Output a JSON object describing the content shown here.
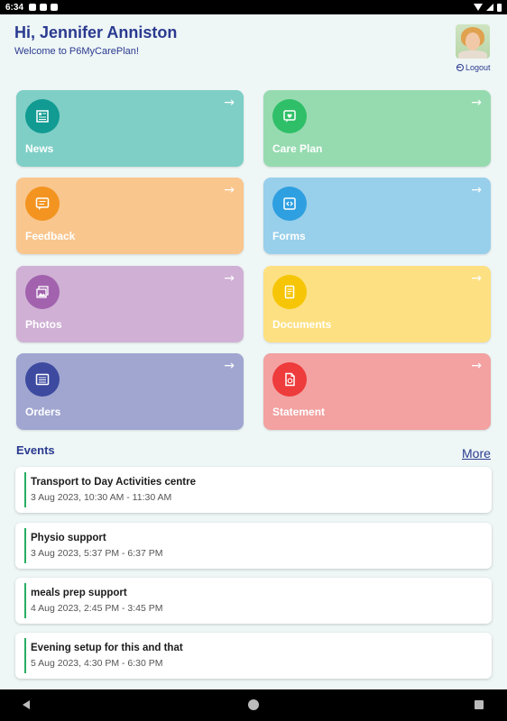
{
  "status_bar": {
    "time": "6:34"
  },
  "header": {
    "greeting": "Hi, Jennifer Anniston",
    "welcome": "Welcome to P6MyCarePlan!",
    "logout": "Logout"
  },
  "tiles": [
    {
      "label": "News",
      "color": "#7fcfc6",
      "icon_color": "#119b92",
      "icon": "newspaper-icon"
    },
    {
      "label": "Care Plan",
      "color": "#96dbb0",
      "icon_color": "#2fbf68",
      "icon": "care-plan-icon"
    },
    {
      "label": "Feedback",
      "color": "#f9c68d",
      "icon_color": "#f39421",
      "icon": "chat-icon"
    },
    {
      "label": "Forms",
      "color": "#98cfeb",
      "icon_color": "#2e9fe0",
      "icon": "code-icon"
    },
    {
      "label": "Photos",
      "color": "#d0b0d5",
      "icon_color": "#a262ae",
      "icon": "photos-icon"
    },
    {
      "label": "Documents",
      "color": "#fde081",
      "icon_color": "#f6c505",
      "icon": "document-icon"
    },
    {
      "label": "Orders",
      "color": "#a0a6d0",
      "icon_color": "#3d4aa0",
      "icon": "list-icon"
    },
    {
      "label": "Statement",
      "color": "#f3a1a1",
      "icon_color": "#ee3b3b",
      "icon": "statement-icon"
    }
  ],
  "events": {
    "title": "Events",
    "more": "More",
    "items": [
      {
        "title": "Transport to Day Activities centre",
        "time": "3 Aug 2023, 10:30 AM - 11:30 AM"
      },
      {
        "title": "Physio support",
        "time": "3 Aug 2023, 5:37 PM - 6:37 PM"
      },
      {
        "title": "meals prep support",
        "time": "4 Aug 2023, 2:45 PM - 3:45 PM"
      },
      {
        "title": "Evening setup for this and that",
        "time": "5 Aug 2023, 4:30 PM - 6:30 PM"
      }
    ]
  }
}
